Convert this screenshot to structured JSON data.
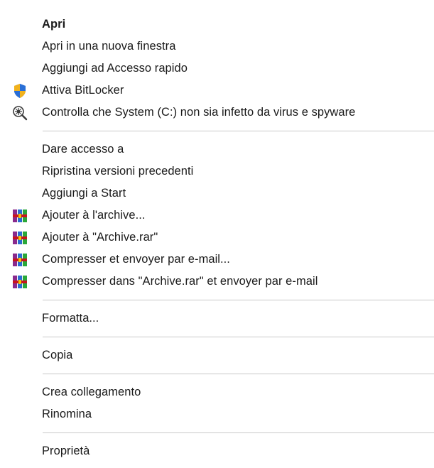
{
  "menu": {
    "groups": [
      {
        "items": [
          {
            "label": "Apri",
            "bold": true,
            "icon": ""
          },
          {
            "label": "Apri in una nuova finestra",
            "icon": ""
          },
          {
            "label": "Aggiungi ad Accesso rapido",
            "icon": ""
          },
          {
            "label": "Attiva BitLocker",
            "icon": "bitlocker-shield-icon"
          },
          {
            "label": "Controlla che System (C:) non sia infetto da virus e spyware",
            "icon": "antivirus-scan-icon"
          }
        ]
      },
      {
        "items": [
          {
            "label": "Dare accesso a",
            "icon": ""
          },
          {
            "label": "Ripristina versioni precedenti",
            "icon": ""
          },
          {
            "label": "Aggiungi a Start",
            "icon": ""
          },
          {
            "label": "Ajouter à l'archive...",
            "icon": "winrar-icon"
          },
          {
            "label": "Ajouter à \"Archive.rar\"",
            "icon": "winrar-icon"
          },
          {
            "label": "Compresser et envoyer par e-mail...",
            "icon": "winrar-icon"
          },
          {
            "label": "Compresser dans \"Archive.rar\" et envoyer par e-mail",
            "icon": "winrar-icon"
          }
        ]
      },
      {
        "items": [
          {
            "label": "Formatta...",
            "icon": ""
          }
        ]
      },
      {
        "items": [
          {
            "label": "Copia",
            "icon": ""
          }
        ]
      },
      {
        "items": [
          {
            "label": "Crea collegamento",
            "icon": ""
          },
          {
            "label": "Rinomina",
            "icon": ""
          }
        ]
      },
      {
        "items": [
          {
            "label": "Proprietà",
            "icon": ""
          }
        ]
      }
    ]
  },
  "colors": {
    "text": "#1a1a1a",
    "separator": "#c8c8c8",
    "background": "#ffffff"
  }
}
